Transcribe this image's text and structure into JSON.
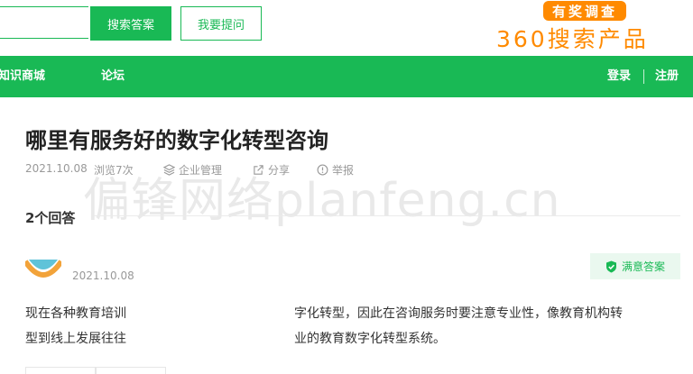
{
  "header": {
    "search_input_placeholder": "",
    "search_button": "搜索答案",
    "ask_button": "我要提问",
    "brand_badge": "有奖调查",
    "brand_name": "360搜索产品"
  },
  "nav": {
    "left_items": [
      "知识商城",
      "论坛"
    ],
    "login": "登录",
    "register": "注册"
  },
  "question": {
    "title": "哪里有服务好的数字化转型咨询",
    "date": "2021.10.08",
    "views": "浏览7次",
    "category": "企业管理",
    "share": "分享",
    "report": "举报"
  },
  "watermark": "偏锋网络planfeng.cn",
  "answers": {
    "count_label": "2个回答",
    "first": {
      "date": "2021.10.08",
      "badge": "满意答案",
      "line1_a": "现在各种教育培训",
      "line1_b": "字化转型，因此在咨询服务时要注意专业性，像教育机构转",
      "line2_a": "型到线上发展往往",
      "line2_b": "业的教育数字化转型系统。"
    }
  },
  "colors": {
    "brand_green": "#19b955",
    "brand_orange": "#ff8a00"
  }
}
